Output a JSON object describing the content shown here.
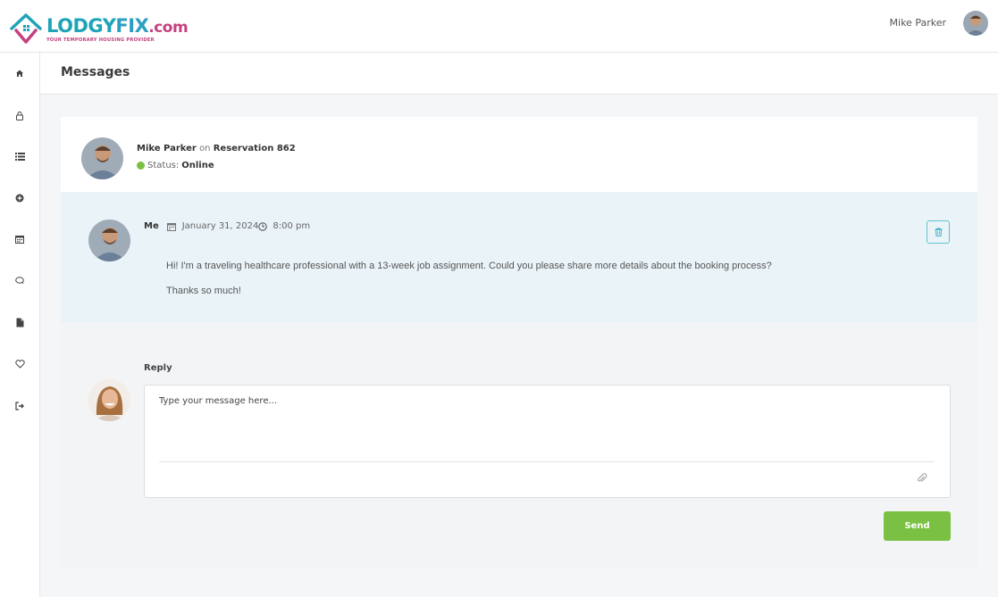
{
  "brand": {
    "name_part1": "LODGY",
    "name_part2": "FIX",
    "name_part3": ".com",
    "tagline": "YOUR TEMPORARY HOUSING PROVIDER",
    "colors": {
      "teal": "#1fa3b7",
      "magenta": "#c4417f"
    }
  },
  "header": {
    "user_name": "Mike Parker"
  },
  "sidebar": {
    "items": [
      {
        "icon": "home-icon"
      },
      {
        "icon": "lock-icon"
      },
      {
        "icon": "list-icon"
      },
      {
        "icon": "plus-circle-icon"
      },
      {
        "icon": "calendar-icon"
      },
      {
        "icon": "chat-icon"
      },
      {
        "icon": "file-icon"
      },
      {
        "icon": "heart-icon"
      },
      {
        "icon": "sign-out-icon"
      }
    ]
  },
  "page": {
    "title": "Messages"
  },
  "thread": {
    "contact_name": "Mike Parker",
    "on_word": "on",
    "reservation": "Reservation 862",
    "status_label": "Status:",
    "status_value": "Online",
    "status_color": "#7ac143"
  },
  "message": {
    "author": "Me",
    "date": "January 31, 2024",
    "time": "8:00 pm",
    "line1": "Hi! I'm a traveling healthcare professional with a 13-week job assignment. Could you please share more details about the booking process?",
    "line2": "Thanks so much!"
  },
  "reply": {
    "label": "Reply",
    "placeholder": "Type your message here...",
    "value": "",
    "send_label": "Send",
    "send_color": "#7ac143"
  }
}
